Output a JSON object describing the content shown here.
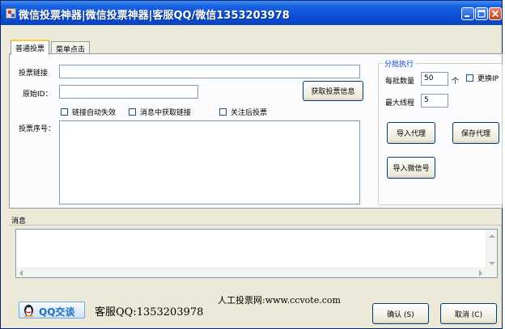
{
  "window": {
    "title": "微信投票神器|微信投票神器|客服QQ/微信1353203978"
  },
  "tabs": [
    {
      "label": "普通投票",
      "active": true
    },
    {
      "label": "菜单点击",
      "active": false
    }
  ],
  "form": {
    "vote_link_label": "投票链接",
    "vote_link_value": "",
    "origin_id_label": "原始ID：",
    "origin_id_value": "",
    "get_info_button": "获取投票信息",
    "checkboxes": [
      {
        "label": "链接自动失效",
        "checked": false
      },
      {
        "label": "消息中获取链接",
        "checked": false
      },
      {
        "label": "关注后投票",
        "checked": false
      }
    ],
    "vote_no_label": "投票序号：",
    "vote_no_value": ""
  },
  "batch": {
    "group_title": "分批执行",
    "per_batch_label": "每批数量",
    "per_batch_value": "50",
    "per_batch_unit": "个",
    "change_ip_label": "更换IP",
    "change_ip_checked": false,
    "max_threads_label": "最大线程",
    "max_threads_value": "5",
    "import_proxy_button": "导入代理",
    "save_proxy_button": "保存代理",
    "import_wechat_button": "导入微信号"
  },
  "messages": {
    "label": "消息",
    "content": ""
  },
  "footer": {
    "qq_button": "QQ交谈",
    "service_text": "客服QQ:1353203978",
    "site_text": "人工投票网:www.ccvote.com",
    "ok_button": "确认 (S)",
    "cancel_button": "取消 (C)"
  },
  "colors": {
    "titlebar": "#0b4fd6",
    "window_bg": "#ece9d8",
    "input_border": "#7f9db9",
    "group_title": "#0046d5",
    "qq_text": "#1f6ec2"
  },
  "icons": [
    "app-icon",
    "minimize-icon",
    "maximize-icon",
    "close-icon",
    "qq-penguin-icon",
    "scroll-up-icon",
    "scroll-down-icon",
    "scroll-left-icon",
    "scroll-right-icon"
  ]
}
